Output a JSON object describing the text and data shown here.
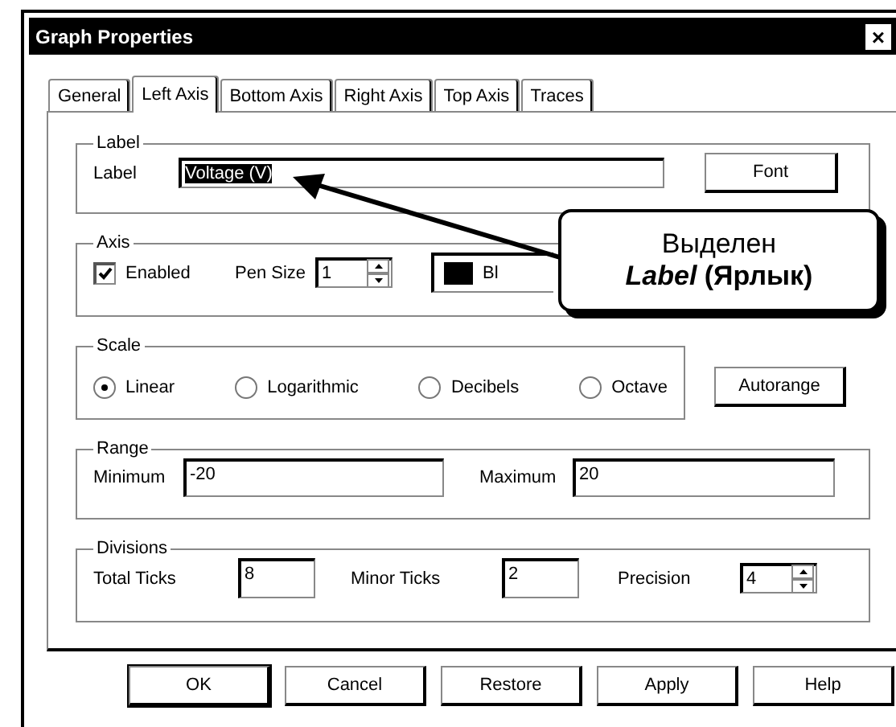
{
  "window": {
    "title": "Graph Properties",
    "close": "×"
  },
  "tabs": [
    {
      "label": "General",
      "selected": false
    },
    {
      "label": "Left Axis",
      "selected": true
    },
    {
      "label": "Bottom Axis",
      "selected": false
    },
    {
      "label": "Right Axis",
      "selected": false
    },
    {
      "label": "Top Axis",
      "selected": false
    },
    {
      "label": "Traces",
      "selected": false
    }
  ],
  "label_group": {
    "title": "Label",
    "field_label": "Label",
    "value": "Voltage (V)",
    "highlighted": true,
    "font_button": "Font"
  },
  "axis_group": {
    "title": "Axis",
    "enabled": {
      "label": "Enabled",
      "checked": true
    },
    "pen_size": {
      "label": "Pen Size",
      "value": "1"
    },
    "pen_color": {
      "color": "#000000",
      "text": "Bl"
    }
  },
  "scale_group": {
    "title": "Scale",
    "options": [
      {
        "label": "Linear",
        "selected": true
      },
      {
        "label": "Logarithmic",
        "selected": false
      },
      {
        "label": "Decibels",
        "selected": false
      },
      {
        "label": "Octave",
        "selected": false
      }
    ],
    "autorange": "Autorange"
  },
  "range_group": {
    "title": "Range",
    "minimum": {
      "label": "Minimum",
      "value": "-20"
    },
    "maximum": {
      "label": "Maximum",
      "value": "20"
    }
  },
  "divisions_group": {
    "title": "Divisions",
    "total_ticks": {
      "label": "Total Ticks",
      "value": "8"
    },
    "minor_ticks": {
      "label": "Minor Ticks",
      "value": "2"
    },
    "precision": {
      "label": "Precision",
      "value": "4"
    }
  },
  "buttons": [
    {
      "label": "OK",
      "default": true
    },
    {
      "label": "Cancel",
      "default": false
    },
    {
      "label": "Restore",
      "default": false
    },
    {
      "label": "Apply",
      "default": false
    },
    {
      "label": "Help",
      "default": false
    }
  ],
  "callout": {
    "lines": [
      "Выделен",
      "*Label* (Ярлык)"
    ]
  }
}
